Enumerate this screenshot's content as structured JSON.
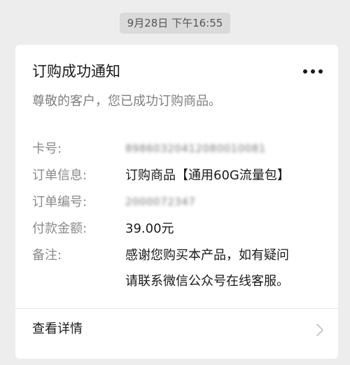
{
  "timestamp": "9月28日 下午16:55",
  "card": {
    "title": "订购成功通知",
    "more_icon": "more-dots-icon",
    "greeting": "尊敬的客户，您已成功订购商品。",
    "fields": {
      "card_number": {
        "label": "卡号:",
        "value": "89860320412080010081"
      },
      "order_info": {
        "label": "订单信息:",
        "value": "订购商品【通用60G流量包】"
      },
      "order_number": {
        "label": "订单编号:",
        "value": "2000072347"
      },
      "payment_amount": {
        "label": "付款金额:",
        "value": "39.00元"
      },
      "remarks": {
        "label": "备注:",
        "line1": "感谢您购买本产品，如有疑问",
        "line2": "请联系微信公众号在线客服。"
      }
    },
    "footer": {
      "details_label": "查看详情",
      "chevron_icon": "chevron-right-icon"
    }
  }
}
